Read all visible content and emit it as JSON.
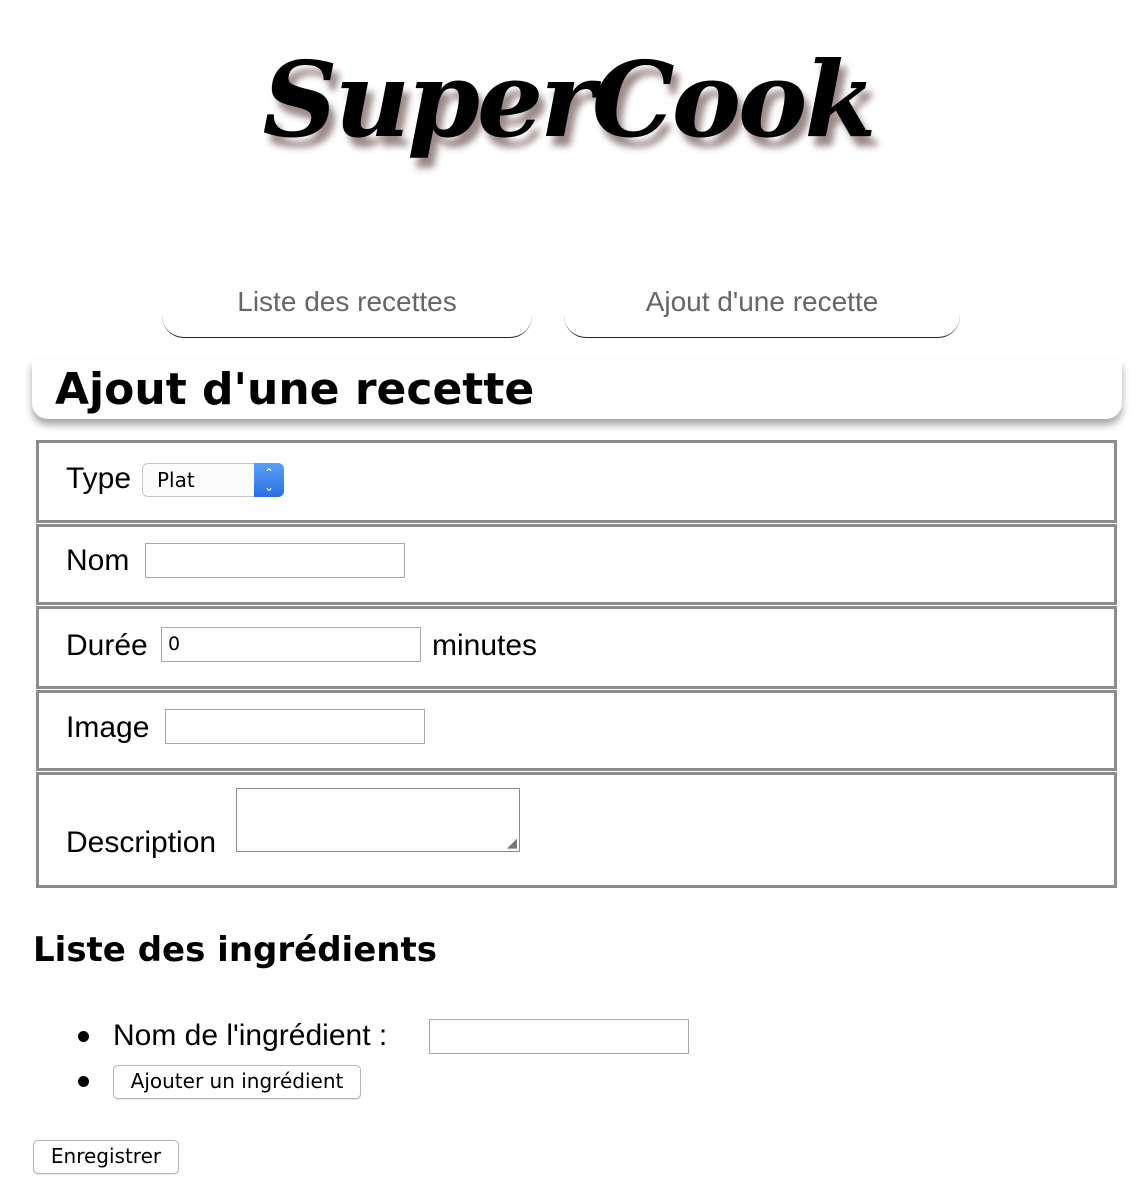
{
  "header": {
    "logo_text": "SuperCook"
  },
  "nav": {
    "tabs": [
      {
        "label": "Liste des recettes"
      },
      {
        "label": "Ajout d'une recette"
      }
    ]
  },
  "page": {
    "title": "Ajout d'une recette"
  },
  "form": {
    "type": {
      "label": "Type",
      "selected": "Plat",
      "stepper_up": "⌃",
      "stepper_down": "⌄"
    },
    "nom": {
      "label": "Nom",
      "value": ""
    },
    "duree": {
      "label": "Durée",
      "value": "0",
      "unit": "minutes"
    },
    "image": {
      "label": "Image",
      "value": ""
    },
    "description": {
      "label": "Description",
      "value": ""
    }
  },
  "ingredients": {
    "title": "Liste des ingrédients",
    "name_label": "Nom de l'ingrédient :",
    "name_value": "",
    "add_button": "Ajouter un ingrédient"
  },
  "actions": {
    "save_label": "Enregistrer"
  }
}
